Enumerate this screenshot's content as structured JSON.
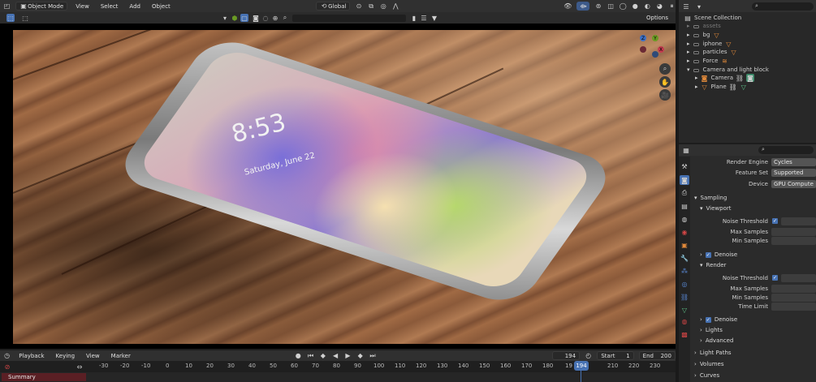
{
  "header": {
    "mode": "Object Mode",
    "menus": [
      "View",
      "Select",
      "Add",
      "Object"
    ],
    "transform_orientation": "Global",
    "options": "Options"
  },
  "viewport": {
    "clock_text": "8:53",
    "date_text": "Saturday, June 22"
  },
  "gizmo": {
    "x": "X",
    "y": "Y",
    "z": "Z"
  },
  "timeline": {
    "menus": [
      "Playback",
      "Keying",
      "View",
      "Marker"
    ],
    "current_frame": "194",
    "start_label": "Start",
    "start_value": "1",
    "end_label": "End",
    "end_value": "200",
    "ticks": [
      "-30",
      "-20",
      "-10",
      "0",
      "10",
      "20",
      "30",
      "40",
      "50",
      "60",
      "70",
      "80",
      "90",
      "100",
      "110",
      "120",
      "130",
      "140",
      "150",
      "160",
      "170",
      "180",
      "19",
      "210",
      "220",
      "230"
    ],
    "summary": "Summary"
  },
  "outliner": {
    "items": [
      {
        "label": "Scene Collection",
        "level": 0
      },
      {
        "label": "assets",
        "level": 1
      },
      {
        "label": "bg",
        "level": 1
      },
      {
        "label": "iphone",
        "level": 1
      },
      {
        "label": "particles",
        "level": 1
      },
      {
        "label": "Force",
        "level": 1
      },
      {
        "label": "Camera and light block",
        "level": 1
      },
      {
        "label": "Camera",
        "level": 2
      },
      {
        "label": "Plane",
        "level": 2
      }
    ]
  },
  "properties": {
    "render_engine_label": "Render Engine",
    "render_engine_value": "Cycles",
    "feature_set_label": "Feature Set",
    "feature_set_value": "Supported",
    "device_label": "Device",
    "device_value": "GPU Compute",
    "sampling": "Sampling",
    "viewport": "Viewport",
    "noise_threshold": "Noise Threshold",
    "max_samples": "Max Samples",
    "min_samples": "Min Samples",
    "denoise": "Denoise",
    "render": "Render",
    "time_limit": "Time Limit",
    "lights": "Lights",
    "advanced": "Advanced",
    "light_paths": "Light Paths",
    "volumes": "Volumes",
    "curves": "Curves"
  },
  "colors": {
    "accent": "#4772b3",
    "x_axis": "#c43c4f",
    "y_axis": "#6a9a23",
    "z_axis": "#3b6fc4"
  }
}
